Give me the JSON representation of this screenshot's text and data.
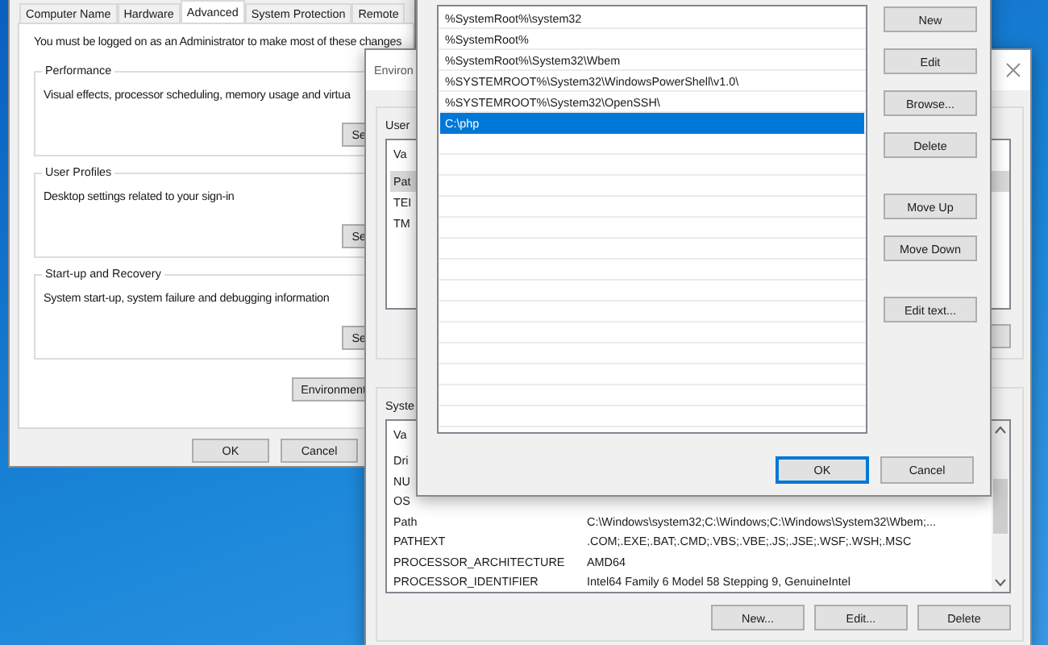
{
  "system_properties": {
    "tabs": [
      {
        "label": "Computer Name",
        "selected": false
      },
      {
        "label": "Hardware",
        "selected": false
      },
      {
        "label": "Advanced",
        "selected": true
      },
      {
        "label": "System Protection",
        "selected": false
      },
      {
        "label": "Remote",
        "selected": false
      }
    ],
    "notice": "You must be logged on as an Administrator to make most of these changes",
    "groups": [
      {
        "title": "Performance",
        "description": "Visual effects, processor scheduling, memory usage and virtua",
        "button": "Se"
      },
      {
        "title": "User Profiles",
        "description": "Desktop settings related to your sign-in",
        "button": "Se"
      },
      {
        "title": "Start-up and Recovery",
        "description": "System start-up, system failure and debugging information",
        "button": "Se"
      }
    ],
    "environment_button": "Environment",
    "buttons": [
      "OK",
      "Cancel"
    ]
  },
  "environment_variables": {
    "title": "Environ",
    "user_section": {
      "label": "User",
      "header": "Va",
      "rows": [
        {
          "name": "Pat",
          "selected": true
        },
        {
          "name": "TEI",
          "selected": false
        },
        {
          "name": "TM",
          "selected": false
        }
      ]
    },
    "system_section": {
      "label": "Syste",
      "header": "Va",
      "rows": [
        {
          "name": "Dri"
        },
        {
          "name": "NU"
        },
        {
          "name": "OS"
        },
        {
          "name": "Path",
          "value": "C:\\Windows\\system32;C:\\Windows;C:\\Windows\\System32\\Wbem;..."
        },
        {
          "name": "PATHEXT",
          "value": ".COM;.EXE;.BAT;.CMD;.VBS;.VBE;.JS;.JSE;.WSF;.WSH;.MSC"
        },
        {
          "name": "PROCESSOR_ARCHITECTURE",
          "value": "AMD64"
        },
        {
          "name": "PROCESSOR_IDENTIFIER",
          "value": "Intel64 Family 6 Model 58 Stepping 9, GenuineIntel"
        }
      ],
      "buttons": [
        "New...",
        "Edit...",
        "Delete"
      ]
    }
  },
  "edit_dialog": {
    "entries": [
      {
        "text": "%SystemRoot%\\system32",
        "selected": false
      },
      {
        "text": "%SystemRoot%",
        "selected": false
      },
      {
        "text": "%SystemRoot%\\System32\\Wbem",
        "selected": false
      },
      {
        "text": "%SYSTEMROOT%\\System32\\WindowsPowerShell\\v1.0\\",
        "selected": false
      },
      {
        "text": "%SYSTEMROOT%\\System32\\OpenSSH\\",
        "selected": false
      },
      {
        "text": "C:\\php",
        "selected": true
      }
    ],
    "button_groups": [
      [
        "New",
        "Edit",
        "Browse...",
        "Delete"
      ],
      [
        "Move Up",
        "Move Down"
      ],
      [
        "Edit text..."
      ]
    ],
    "ok": "OK",
    "cancel": "Cancel"
  }
}
